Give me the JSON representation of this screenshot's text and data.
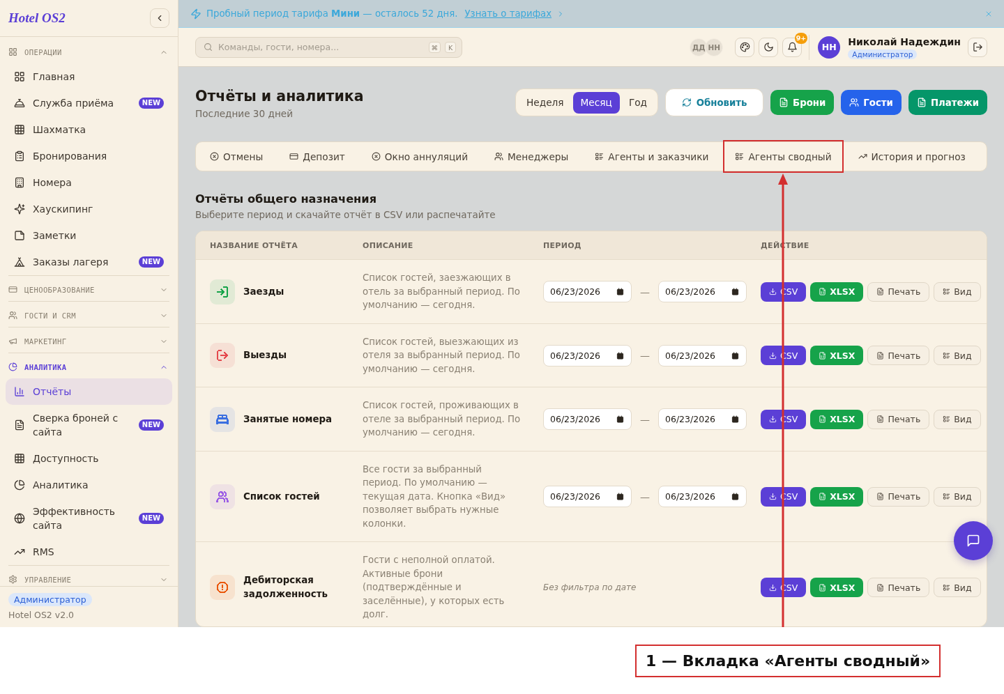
{
  "sidebar": {
    "logo": "Hotel OS2",
    "sections": [
      {
        "label": "ОПЕРАЦИИ",
        "expanded": true,
        "items": [
          {
            "label": "Главная",
            "selected": false
          },
          {
            "label": "Служба приёма",
            "badge": "NEW",
            "selected": false
          },
          {
            "label": "Шахматка",
            "selected": false
          },
          {
            "label": "Бронирования",
            "selected": false
          },
          {
            "label": "Номера",
            "selected": false
          },
          {
            "label": "Хаускипинг",
            "selected": false
          },
          {
            "label": "Заметки",
            "selected": false
          },
          {
            "label": "Заказы лагеря",
            "badge": "NEW",
            "selected": false
          }
        ]
      },
      {
        "label": "ЦЕНООБРАЗОВАНИЕ",
        "expanded": false
      },
      {
        "label": "ГОСТИ И CRM",
        "expanded": false
      },
      {
        "label": "МАРКЕТИНГ",
        "expanded": false
      },
      {
        "label": "АНАЛИТИКА",
        "expanded": true,
        "items": [
          {
            "label": "Отчёты",
            "selected": true
          },
          {
            "label": "Сверка броней с сайта",
            "badge": "NEW",
            "selected": false
          },
          {
            "label": "Доступность",
            "selected": false
          },
          {
            "label": "Аналитика",
            "selected": false
          },
          {
            "label": "Эффективность сайта",
            "badge": "NEW",
            "selected": false
          },
          {
            "label": "RMS",
            "selected": false
          }
        ]
      },
      {
        "label": "УПРАВЛЕНИЕ",
        "expanded": false
      }
    ],
    "footer": {
      "role": "Администратор",
      "version": "Hotel OS2 v2.0"
    }
  },
  "trial_banner": {
    "text": "Пробный период тарифа **Мини** — осталось 52 дня.",
    "link": "Узнать о тарифах"
  },
  "topbar": {
    "search": {
      "placeholder": "Команды, гости, номера...",
      "shortcut": [
        "⌘",
        "K"
      ]
    },
    "online_users": [
      "ДД",
      "НН"
    ],
    "notifications_badge": "9+",
    "user": {
      "initials": "НН",
      "name": "Николай Надеждин",
      "role": "Администратор"
    }
  },
  "page": {
    "title": "Отчёты и аналитика",
    "subtitle": "Последние 30 дней",
    "periods": [
      {
        "label": "Неделя",
        "selected": false
      },
      {
        "label": "Месяц",
        "selected": true
      },
      {
        "label": "Год",
        "selected": false
      }
    ],
    "refresh_button": "Обновить",
    "actions": [
      {
        "label": "Брони",
        "color": "#16a34a"
      },
      {
        "label": "Гости",
        "color": "#2563eb"
      },
      {
        "label": "Платежи",
        "color": "#059669"
      }
    ]
  },
  "tabs": [
    {
      "label": "Отмены",
      "selected": false,
      "highlighted": false
    },
    {
      "label": "Депозит",
      "selected": false,
      "highlighted": false
    },
    {
      "label": "Окно аннуляций",
      "selected": false,
      "highlighted": false
    },
    {
      "label": "Менеджеры",
      "selected": false,
      "highlighted": false
    },
    {
      "label": "Агенты и заказчики",
      "selected": false,
      "highlighted": false
    },
    {
      "label": "Агенты сводный",
      "selected": false,
      "highlighted": true
    },
    {
      "label": "История и прогноз",
      "selected": false,
      "highlighted": false
    }
  ],
  "reports": {
    "title": "Отчёты общего назначения",
    "subtitle": "Выберите период и скачайте отчёт в CSV или распечатайте",
    "columns": [
      "НАЗВАНИЕ ОТЧЁТА",
      "ОПИСАНИЕ",
      "ПЕРИОД",
      "ДЕЙСТВИЕ"
    ],
    "rows": [
      {
        "name": "Заезды",
        "color": "#16a34a",
        "description": "Список гостей, заезжающих в отель за выбранный период. По умолчанию — сегодня.",
        "period": {
          "kind": "range",
          "from": "06/23/2026",
          "separator": "—",
          "to": "06/23/2026"
        },
        "actions": [
          "CSV",
          "XLSX",
          "Печать",
          "Вид"
        ]
      },
      {
        "name": "Выезды",
        "color": "#e5484d",
        "description": "Список гостей, выезжающих из отеля за выбранный период. По умолчанию — сегодня.",
        "period": {
          "kind": "range",
          "from": "06/23/2026",
          "separator": "—",
          "to": "06/23/2026"
        },
        "actions": [
          "CSV",
          "XLSX",
          "Печать",
          "Вид"
        ]
      },
      {
        "name": "Занятые номера",
        "color": "#3b6fe0",
        "description": "Список гостей, проживающих в отеле за выбранный период. По умолчанию — сегодня.",
        "period": {
          "kind": "range",
          "from": "06/23/2026",
          "separator": "—",
          "to": "06/23/2026"
        },
        "actions": [
          "CSV",
          "XLSX",
          "Печать",
          "Вид"
        ]
      },
      {
        "name": "Список гостей",
        "color": "#9b5de5",
        "description": "Все гости за выбранный период. По умолчанию — текущая дата. Кнопка «Вид» позволяет выбрать нужные колонки.",
        "period": {
          "kind": "range",
          "from": "06/23/2026",
          "separator": "—",
          "to": "06/23/2026"
        },
        "actions": [
          "CSV",
          "XLSX",
          "Печать",
          "Вид"
        ]
      },
      {
        "name": "Дебиторская задолженность",
        "color": "#ea580c",
        "description": "Гости с неполной оплатой. Активные брони (подтверждённые и заселённые), у которых есть долг.",
        "period": {
          "kind": "note",
          "text": "Без фильтра по дате"
        },
        "actions": [
          "CSV",
          "XLSX",
          "Печать",
          "Вид"
        ]
      }
    ]
  },
  "callout": {
    "text": "1 — Вкладка «Агенты сводный»"
  }
}
